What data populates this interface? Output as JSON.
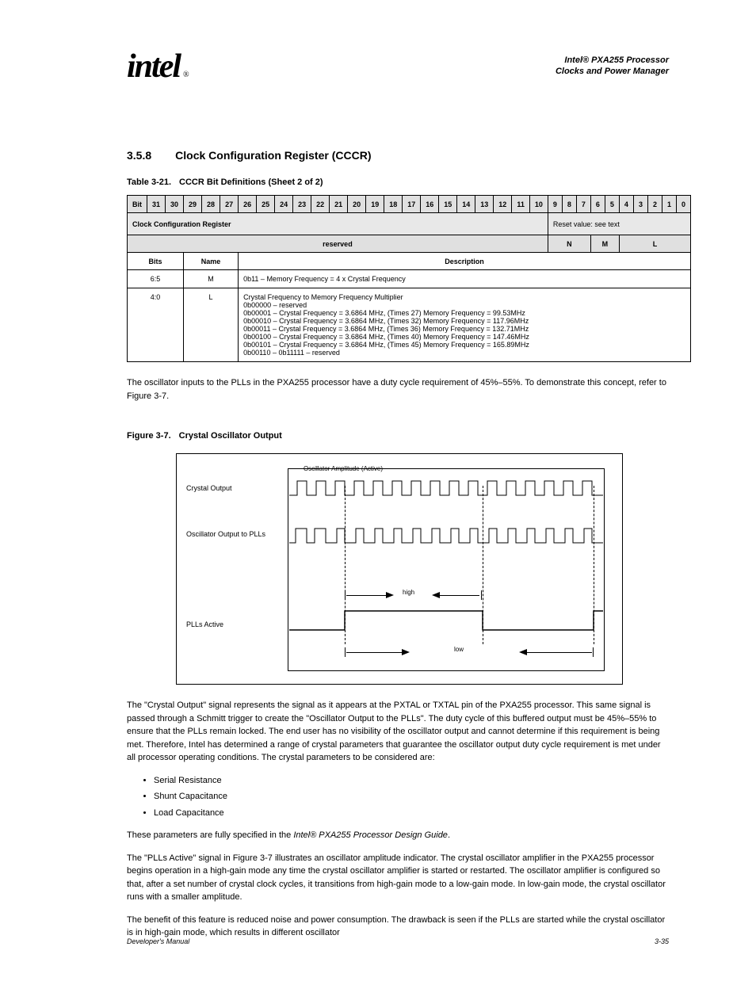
{
  "logo": {
    "text": "intel",
    "reg": "®"
  },
  "header": {
    "line1": "Intel® PXA255 Processor",
    "line2": "Clocks and Power Manager"
  },
  "section": {
    "number": "3.5.8",
    "title": "Clock Configuration Register (CCCR)"
  },
  "table": {
    "caption_label": "Table 3-21.",
    "caption_title": "CCCR Bit Definitions (Sheet 2 of 2)",
    "bit_header_left": "Bit",
    "bit_nums_left": [
      "31",
      "30",
      "29",
      "28",
      "27",
      "26",
      "25",
      "24",
      "23",
      "22",
      "21",
      "20",
      "19",
      "18",
      "17",
      "16"
    ],
    "bit_nums_right": [
      "15",
      "14",
      "13",
      "12",
      "11",
      "10",
      "9",
      "8",
      "7",
      "6",
      "5",
      "4",
      "3",
      "2",
      "1",
      "0"
    ],
    "register_label": "Clock Configuration Register",
    "reset_label": "Reset value: see text",
    "fields": {
      "reserved": "reserved",
      "n": "N",
      "m": "M",
      "l": "L"
    },
    "cols": {
      "bits": "Bits",
      "name": "Name",
      "desc": "Description"
    },
    "rows": [
      {
        "bits": "6:5",
        "name": "M",
        "desc": "0b11 – Memory Frequency = 4 x Crystal Frequency"
      },
      {
        "bits": "4:0",
        "name": "L",
        "desc": "Crystal Frequency to Memory Frequency Multiplier\n0b00000 – reserved\n0b00001 – Crystal Frequency = 3.6864 MHz, (Times 27) Memory Frequency = 99.53MHz\n0b00010 – Crystal Frequency = 3.6864 MHz, (Times 32) Memory Frequency = 117.96MHz\n0b00011 – Crystal Frequency = 3.6864 MHz, (Times 36) Memory Frequency = 132.71MHz\n0b00100 – Crystal Frequency = 3.6864 MHz, (Times 40) Memory Frequency = 147.46MHz\n0b00101 – Crystal Frequency = 3.6864 MHz, (Times 45) Memory Frequency = 165.89MHz\n0b00110 – 0b11111 – reserved"
      }
    ]
  },
  "body": {
    "p1": "The oscillator inputs to the PLLs in the PXA255 processor have a duty cycle requirement of 45%–55%. To demonstrate this concept, refer to Figure 3-7."
  },
  "figure": {
    "caption_label": "Figure 3-7.",
    "caption_title": "Crystal Oscillator Output",
    "lbl_xtal_out": "Crystal Output",
    "lbl_osc_out": "Oscillator Output to PLLs",
    "lbl_plls": "PLLs Active",
    "lbl_osc_state": "Oscillator Amplitude (Active)",
    "lbl_high": "high",
    "lbl_low": "low"
  },
  "body2": {
    "p2": "The \"Crystal Output\" signal represents the signal as it appears at the PXTAL or TXTAL pin of the PXA255 processor. This same signal is passed through a Schmitt trigger to create the \"Oscillator Output to the PLLs\". The duty cycle of this buffered output must be 45%–55% to ensure that the PLLs remain locked. The end user has no visibility of the oscillator output and cannot determine if this requirement is being met. Therefore, Intel has determined a range of crystal parameters that guarantee the oscillator output duty cycle requirement is met under all processor operating conditions. The crystal parameters to be considered are:",
    "bullets": [
      "Serial Resistance",
      "Shunt Capacitance",
      "Load Capacitance"
    ],
    "p3": "These parameters are fully specified in the Intel® PXA255 Processor Design Guide.",
    "p4": "The \"PLLs Active\" signal in Figure 3-7 illustrates an oscillator amplitude indicator. The crystal oscillator amplifier in the PXA255 processor begins operation in a high-gain mode any time the crystal oscillator amplifier is started or restarted. The oscillator amplifier is configured so that, after a set number of crystal clock cycles, it transitions from high-gain mode to a low-gain mode. In low-gain mode, the crystal oscillator runs with a smaller amplitude.",
    "p5": "The benefit of this feature is reduced noise and power consumption. The drawback is seen if the PLLs are started while the crystal oscillator is in high-gain mode, which results in different oscillator"
  },
  "footer": {
    "left": "Developer's Manual",
    "right": "3-35"
  }
}
